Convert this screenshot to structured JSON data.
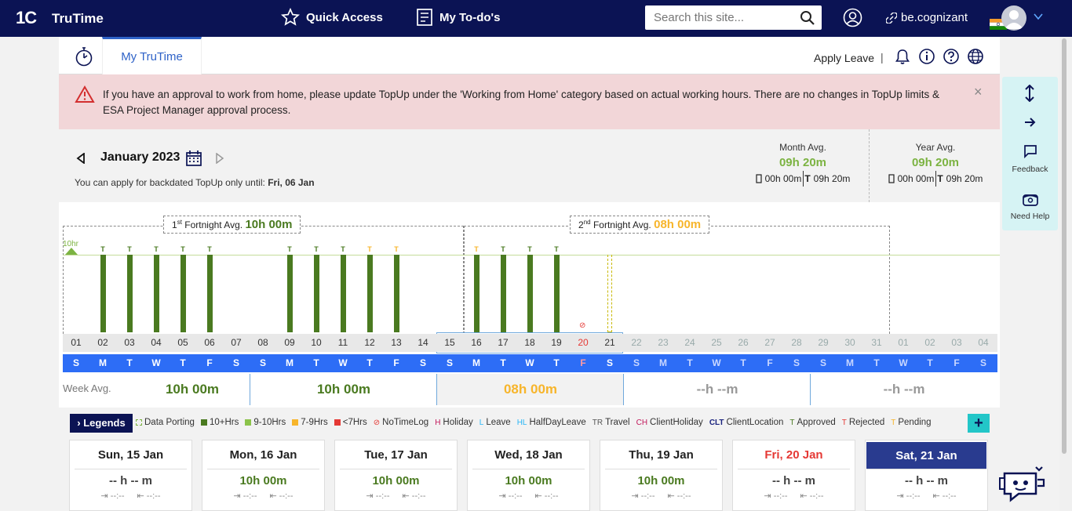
{
  "nav": {
    "logo": "1C",
    "app_name": "TruTime",
    "quick_access": "Quick Access",
    "todo": "My To-do's",
    "search_placeholder": "Search this site...",
    "becognizant": "be.cognizant"
  },
  "subnav": {
    "tab": "My TruTime",
    "apply_leave": "Apply Leave",
    "separator": "|"
  },
  "alert": {
    "message": "If you have an approval to work from home, please update TopUp under the 'Working from Home' category based on actual working hours. There are no changes in TopUp limits & ESA Project Manager approval process.",
    "close": "×"
  },
  "month": {
    "name": "January 2023",
    "note_prefix": "You can apply for backdated TopUp only until:",
    "note_date": "Fri, 06 Jan",
    "month_avg_label": "Month Avg.",
    "month_avg": "09h 20m",
    "month_office": "00h 00m",
    "month_total": "09h 20m",
    "year_avg_label": "Year Avg.",
    "year_avg": "09h 20m",
    "year_office": "00h 00m",
    "year_total": "09h 20m",
    "t_prefix": "T"
  },
  "chart": {
    "ten_label": "10hr",
    "fortnight1_prefix": "1",
    "fortnight1_sup": "st",
    "fortnight1_label": "Fortnight Avg.",
    "fortnight1_value": "10h 00m",
    "fortnight2_prefix": "2",
    "fortnight2_sup": "nd",
    "fortnight2_label": "Fortnight Avg.",
    "fortnight2_value": "08h 00m",
    "t_mark": "T"
  },
  "chart_data": {
    "type": "bar",
    "categories": [
      "01",
      "02",
      "03",
      "04",
      "05",
      "06",
      "07",
      "08",
      "09",
      "10",
      "11",
      "12",
      "13",
      "14",
      "15",
      "16",
      "17",
      "18",
      "19",
      "20",
      "21",
      "22",
      "23",
      "24",
      "25",
      "26",
      "27",
      "28",
      "29",
      "30",
      "31",
      "01",
      "02",
      "03",
      "04"
    ],
    "weekdays": [
      "S",
      "M",
      "T",
      "W",
      "T",
      "F",
      "S",
      "S",
      "M",
      "T",
      "W",
      "T",
      "F",
      "S",
      "S",
      "M",
      "T",
      "W",
      "T",
      "F",
      "S",
      "S",
      "M",
      "T",
      "W",
      "T",
      "F",
      "S",
      "S",
      "M",
      "T",
      "W",
      "T",
      "F",
      "S"
    ],
    "values": [
      0,
      10,
      10,
      10,
      10,
      10,
      0,
      0,
      10,
      10,
      10,
      10,
      10,
      0,
      0,
      10,
      10,
      10,
      10,
      0,
      0,
      0,
      0,
      0,
      0,
      0,
      0,
      0,
      0,
      0,
      0,
      0,
      0,
      0,
      0
    ],
    "status": [
      "",
      "approved",
      "approved",
      "approved",
      "approved",
      "approved",
      "",
      "",
      "approved",
      "approved",
      "approved",
      "pending",
      "pending",
      "",
      "",
      "pending",
      "approved",
      "approved",
      "approved",
      "notimelog",
      "pending-porting",
      "",
      "",
      "",
      "",
      "",
      "",
      "",
      "",
      "",
      "",
      "",
      "",
      "",
      ""
    ],
    "ylim": [
      0,
      10
    ],
    "reference_line": 10
  },
  "week_avg": {
    "label": "Week Avg.",
    "values": [
      "10h 00m",
      "10h 00m",
      "08h 00m",
      "--h --m",
      "--h --m"
    ]
  },
  "legends": {
    "button": "Legends",
    "items": [
      "Data Porting",
      "10+Hrs",
      "9-10Hrs",
      "7-9Hrs",
      "<7Hrs",
      "NoTimeLog",
      "Holiday",
      "Leave",
      "HalfDayLeave",
      "Travel",
      "ClientHoliday",
      "ClientLocation",
      "Approved",
      "Rejected",
      "Pending"
    ],
    "codes": [
      "H",
      "L",
      "HL",
      "TR",
      "CH",
      "CLT",
      "T",
      "T",
      "T"
    ],
    "plus": "+"
  },
  "colors": {
    "nav_bg": "#0b1354",
    "tab_accent": "#2f63c8",
    "alert_bg": "#f2d6d8",
    "bar_green": "#4a7a20",
    "light_green": "#7cb342",
    "orange": "#f7b52b",
    "red": "#e53935",
    "day_strip": "#2d6df6",
    "float_panel": "#d6f3f4"
  },
  "cards": [
    {
      "title": "Sun, 15 Jan",
      "hours": "-- h -- m",
      "in": "--:--",
      "out": "--:--"
    },
    {
      "title": "Mon, 16 Jan",
      "hours": "10h 00m",
      "in": "--:--",
      "out": "--:--"
    },
    {
      "title": "Tue, 17 Jan",
      "hours": "10h 00m",
      "in": "--:--",
      "out": "--:--"
    },
    {
      "title": "Wed, 18 Jan",
      "hours": "10h 00m",
      "in": "--:--",
      "out": "--:--"
    },
    {
      "title": "Thu, 19 Jan",
      "hours": "10h 00m",
      "in": "--:--",
      "out": "--:--"
    },
    {
      "title": "Fri, 20 Jan",
      "hours": "-- h -- m",
      "in": "--:--",
      "out": "--:--"
    },
    {
      "title": "Sat, 21 Jan",
      "hours": "-- h -- m",
      "in": "--:--",
      "out": "--:--"
    }
  ],
  "float_panel": {
    "feedback": "Feedback",
    "need_help": "Need Help"
  },
  "icons": [
    "star-icon",
    "checklist-icon",
    "search-icon",
    "user-icon",
    "link-icon",
    "india-flag-icon",
    "avatar-icon",
    "chevron-down-icon",
    "stopwatch-icon",
    "bell-icon",
    "info-icon",
    "help-icon",
    "globe-icon",
    "warning-icon",
    "close-icon",
    "chevron-left-icon",
    "calendar-icon",
    "chevron-right-icon",
    "expand-vertical-icon",
    "arrow-right-icon",
    "chat-icon",
    "phone-icon",
    "chatbot-icon"
  ]
}
